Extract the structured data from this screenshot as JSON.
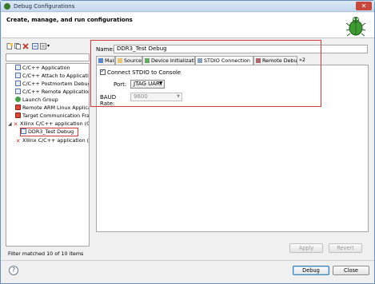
{
  "window": {
    "title": "Debug Configurations",
    "close_glyph": "✕"
  },
  "banner": {
    "heading": "Create, manage, and run configurations",
    "icon": "debug-bug-icon"
  },
  "toolbar": {
    "collapse_glyph": "▾"
  },
  "tree": {
    "items": [
      {
        "label": "C/C++ Application",
        "icon": "c-app-icon"
      },
      {
        "label": "C/C++ Attach to Application",
        "icon": "c-app-icon"
      },
      {
        "label": "C/C++ Postmortem Debugger",
        "icon": "c-app-icon"
      },
      {
        "label": "C/C++ Remote Application",
        "icon": "c-app-icon"
      },
      {
        "label": "Launch Group",
        "icon": "launch-group-icon"
      },
      {
        "label": "Remote ARM Linux Application",
        "icon": "remote-arm-icon"
      },
      {
        "label": "Target Communication Framework",
        "icon": "tcf-icon"
      },
      {
        "label": "Xilinx C/C++ application (GDB)",
        "icon": "xilinx-icon",
        "expanded": true
      },
      {
        "label": "DDR3_Test Debug",
        "icon": "c-app-icon",
        "selected": true
      },
      {
        "label": "Xilinx C/C++ application (System Debugger)",
        "icon": "xilinx-icon"
      }
    ],
    "expander_glyph": "◢"
  },
  "filter_status": "Filter matched 10 of 10 items",
  "config": {
    "name_label": "Name:",
    "name_value": "DDR3_Test Debug",
    "tabs": [
      {
        "label": "Main",
        "icon": "main-tab-icon"
      },
      {
        "label": "Source",
        "icon": "source-tab-icon"
      },
      {
        "label": "Device Initialization",
        "icon": "device-tab-icon"
      },
      {
        "label": "STDIO Connection",
        "icon": "stdio-tab-icon",
        "active": true
      },
      {
        "label": "Remote Debug",
        "icon": "remote-tab-icon"
      }
    ],
    "tabs_overflow": "»2",
    "connect_label": "Connect STDIO to Console",
    "connect_checked": true,
    "port_label": "Port:",
    "port_value": "JTAG UART",
    "baud_label": "BAUD Rate:",
    "baud_value": "9600",
    "dropdown_glyph": "▼"
  },
  "buttons": {
    "apply": "Apply",
    "revert": "Revert",
    "debug": "Debug",
    "close": "Close",
    "help": "?"
  },
  "colors": {
    "highlight_red": "#d23a3a",
    "title_gradient_top": "#dbe8f7"
  }
}
